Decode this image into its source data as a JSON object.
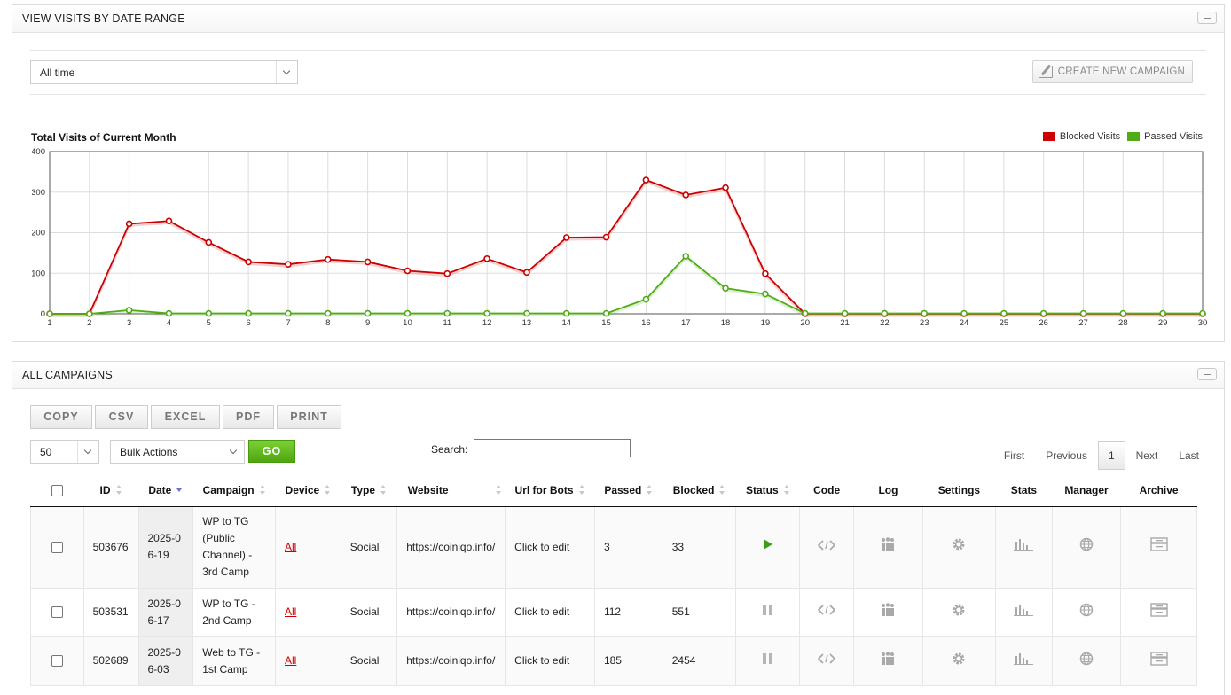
{
  "visits_panel": {
    "title": "VIEW VISITS BY DATE RANGE",
    "date_range": "All time",
    "create_button": "CREATE NEW CAMPAIGN"
  },
  "chart_data": {
    "type": "line",
    "title": "Total Visits of Current Month",
    "x": [
      1,
      2,
      3,
      4,
      5,
      6,
      7,
      8,
      9,
      10,
      11,
      12,
      13,
      14,
      15,
      16,
      17,
      18,
      19,
      20,
      21,
      22,
      23,
      24,
      25,
      26,
      27,
      28,
      29,
      30
    ],
    "ylim": [
      0,
      400
    ],
    "yticks": [
      0,
      100,
      200,
      300,
      400
    ],
    "grid": true,
    "legend_position": "top-right",
    "series": [
      {
        "name": "Blocked Visits",
        "color": "#cc0000",
        "values": [
          0,
          0,
          222,
          229,
          176,
          128,
          122,
          134,
          128,
          106,
          99,
          136,
          102,
          188,
          189,
          330,
          293,
          311,
          99,
          0,
          0,
          0,
          0,
          0,
          0,
          0,
          0,
          0,
          0,
          0
        ]
      },
      {
        "name": "Passed Visits",
        "color": "#4fac16",
        "values": [
          0,
          0,
          9,
          1,
          1,
          1,
          1,
          1,
          1,
          1,
          1,
          1,
          1,
          1,
          1,
          36,
          142,
          63,
          49,
          1,
          1,
          1,
          1,
          1,
          1,
          1,
          1,
          1,
          1,
          1
        ]
      }
    ]
  },
  "campaigns_panel": {
    "title": "ALL CAMPAIGNS",
    "export_buttons": [
      "COPY",
      "CSV",
      "EXCEL",
      "PDF",
      "PRINT"
    ],
    "page_size": "50",
    "bulk_actions": "Bulk Actions",
    "go_label": "GO",
    "search_label": "Search:",
    "search_value": "",
    "pager": {
      "first": "First",
      "previous": "Previous",
      "current": "1",
      "next": "Next",
      "last": "Last"
    },
    "columns": [
      "ID",
      "Date",
      "Campaign",
      "Device",
      "Type",
      "Website",
      "Url for Bots",
      "Passed",
      "Blocked",
      "Status",
      "Code",
      "Log",
      "Settings",
      "Stats",
      "Manager",
      "Archive"
    ],
    "rows": [
      {
        "id": "503676",
        "date": "2025-06-19",
        "campaign": "WP to TG (Public Channel) - 3rd Camp",
        "device": "All",
        "type": "Social",
        "website": "https://coiniqo.info/",
        "url_for_bots": "Click to edit",
        "passed": "3",
        "blocked": "33",
        "status": "play-icon"
      },
      {
        "id": "503531",
        "date": "2025-06-17",
        "campaign": "WP to TG - 2nd Camp",
        "device": "All",
        "type": "Social",
        "website": "https://coiniqo.info/",
        "url_for_bots": "Click to edit",
        "passed": "112",
        "blocked": "551",
        "status": "pause-icon"
      },
      {
        "id": "502689",
        "date": "2025-06-03",
        "campaign": "Web to TG - 1st Camp",
        "device": "All",
        "type": "Social",
        "website": "https://coiniqo.info/",
        "url_for_bots": "Click to edit",
        "passed": "185",
        "blocked": "2454",
        "status": "pause-icon"
      }
    ]
  }
}
